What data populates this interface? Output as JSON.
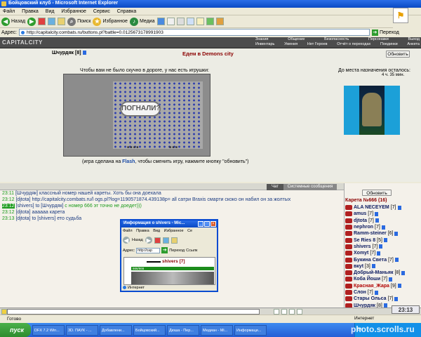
{
  "window": {
    "title": "Бойцовский клуб - Microsoft Internet Explorer"
  },
  "menu": [
    "Файл",
    "Правка",
    "Вид",
    "Избранное",
    "Сервис",
    "Справка"
  ],
  "toolbar": {
    "back": "Назад",
    "search": "Поиск",
    "favorites": "Избранное",
    "media": "Медиа"
  },
  "address": {
    "label": "Адрес:",
    "url": "http://capitalcity.combats.ru/buttons.pl?battle=0.0125673178991903",
    "go": "Переход",
    "links": "Ссылки"
  },
  "site": {
    "logo": "CAPITALCITY",
    "nav_top": [
      "Знания",
      "Общение",
      "Безопасность",
      "Персонажи",
      "Выход"
    ],
    "nav_bottom": [
      "Инвентарь",
      "Умения",
      "Нет Героев",
      "Отчёт о переходах",
      "Поединки",
      "Анкета"
    ]
  },
  "game": {
    "player_name": "Шчурдяк",
    "player_level": "[8]",
    "travel_title": "Едем в Demons city",
    "refresh_label": "Обновить",
    "bored_text": "Чтобы вам не было скучно в дороге, у нас есть игрушки:",
    "dest_label": "До места назначения осталось:",
    "dest_time": "4 ч. 35 мин.",
    "game_logo": "ПОГНАЛИ?",
    "flash_note_pre": "(игра сделана на ",
    "flash_word": "Flash",
    "flash_note_post": ", чтобы сменить игру, нажмите кнопку \"обновить\")"
  },
  "chat": {
    "tabs": [
      "Чат",
      "Системные сообщения"
    ],
    "lines": [
      {
        "time": "23:11",
        "nick": "[Шчурдяк]",
        "text": "классный номер нашей кареты. Хоть бы она доехала"
      },
      {
        "time": "23:12",
        "nick": "[djtota]",
        "text": "http://capitalcity.combats.ru/l ogs.pl?log=1190571874.439138p= all сатри Braxis смарти скоко он набил он за жолтых"
      },
      {
        "time": "23:12",
        "nick": "[shivers]",
        "mid": "to [Шчурдяк]",
        "text": "с номер 666 эт точно не доедет)))"
      },
      {
        "time": "23:12",
        "nick": "[djtota]",
        "text": "аааааа карета"
      },
      {
        "time": "23:13",
        "nick": "[djtota]",
        "mid": "to [shivers]",
        "text": "ето судьба"
      }
    ]
  },
  "room": {
    "refresh_label": "Обновить",
    "title": "Карета №666 (16)",
    "users": [
      {
        "name": "ALA NECEYEM",
        "level": "[7]"
      },
      {
        "name": "amus",
        "level": "[7]"
      },
      {
        "name": "djtota",
        "level": "[7]"
      },
      {
        "name": "nephron",
        "level": "[7]"
      },
      {
        "name": "Ramm-steiner",
        "level": "[6]"
      },
      {
        "name": "Se Ries 8",
        "level": "[5]"
      },
      {
        "name": "shivers",
        "level": "[7]"
      },
      {
        "name": "Xomyt",
        "level": "[7]"
      },
      {
        "name": "Букина Света",
        "level": "[7]"
      },
      {
        "name": "вкуt",
        "level": "[3]"
      },
      {
        "name": "Добрый-Маньяк",
        "level": "[8]"
      },
      {
        "name": "Коба Йоши",
        "level": "[7]"
      },
      {
        "name": "Красная_Жара",
        "level": "[9]"
      },
      {
        "name": "Слон",
        "level": "[7]"
      },
      {
        "name": "Стары Ольса",
        "level": "[7]"
      },
      {
        "name": "Шчурдяк",
        "level": "[8]"
      }
    ]
  },
  "clock": "23:13",
  "status": {
    "left": "Готово",
    "right": "Интернет"
  },
  "popup": {
    "title": "Информация о shivers - Mic...",
    "menu": [
      "Файл",
      "Правка",
      "Вид",
      "Избранное",
      "Се"
    ],
    "back": "Назад",
    "addr_label": "Адрес:",
    "addr_value": "http://cap",
    "go": "Переход",
    "links": "Ссылк",
    "name": "shivers",
    "level": "[7]",
    "hp": "666/666",
    "status": "Интернет"
  },
  "taskbar": {
    "start": "пуск",
    "tasks": [
      "DFX 7.2 Win...",
      "3D. ПАУК - ...",
      "Добавлени...",
      "Бойцовский...",
      "Дюша - Пер...",
      "Медиан - Mi...",
      "Информаци..."
    ],
    "lang": "EN"
  },
  "watermark": "photo.scrolls.ru"
}
